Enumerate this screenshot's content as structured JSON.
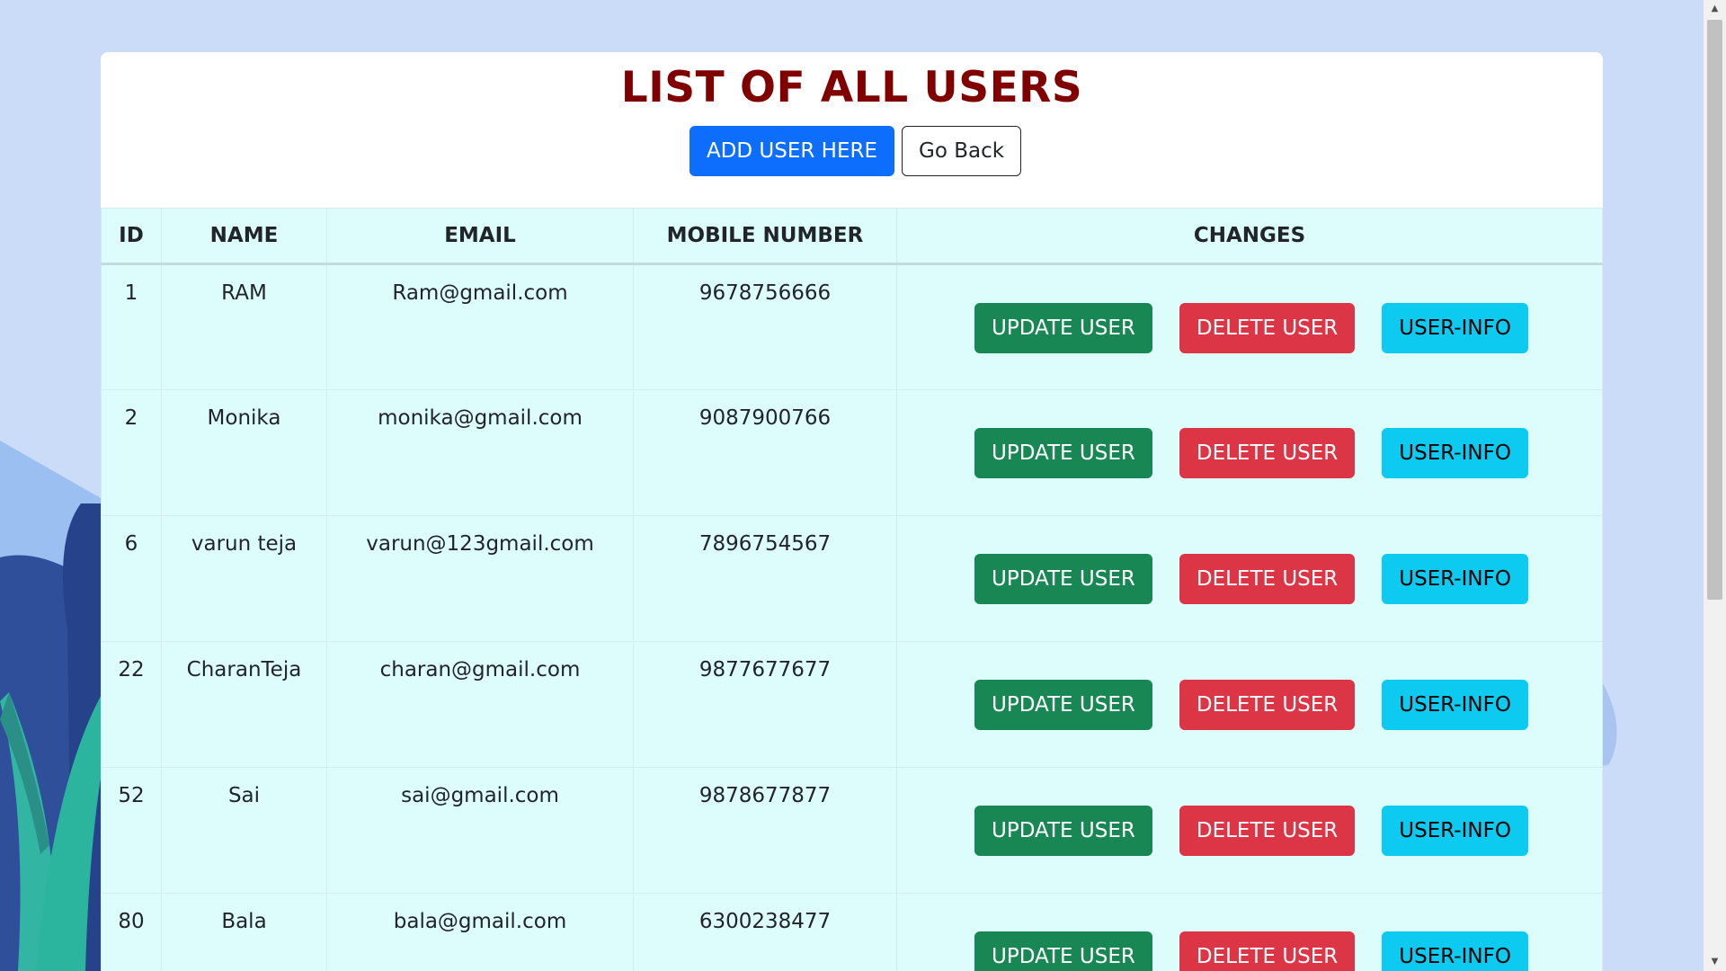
{
  "page": {
    "title": "LIST OF ALL USERS",
    "add_user_label": "ADD USER HERE",
    "go_back_label": "Go Back"
  },
  "table": {
    "headers": [
      "ID",
      "NAME",
      "EMAIL",
      "MOBILE NUMBER",
      "CHANGES"
    ],
    "rows": [
      {
        "id": "1",
        "name": "RAM",
        "email": "Ram@gmail.com",
        "mobile": "9678756666"
      },
      {
        "id": "2",
        "name": "Monika",
        "email": "monika@gmail.com",
        "mobile": "9087900766"
      },
      {
        "id": "6",
        "name": "varun teja",
        "email": "varun@123gmail.com",
        "mobile": "7896754567"
      },
      {
        "id": "22",
        "name": "CharanTeja",
        "email": "charan@gmail.com",
        "mobile": "9877677677"
      },
      {
        "id": "52",
        "name": "Sai",
        "email": "sai@gmail.com",
        "mobile": "9878677877"
      },
      {
        "id": "80",
        "name": "Bala",
        "email": "bala@gmail.com",
        "mobile": "6300238477"
      }
    ],
    "actions": {
      "update_label": "UPDATE USER",
      "delete_label": "DELETE USER",
      "info_label": "USER-INFO"
    }
  },
  "colors": {
    "page_background": "#cadcf8",
    "title": "#800000",
    "table_background": "#ddfdfd",
    "primary": "#0d6efd",
    "success": "#198754",
    "danger": "#dc3545",
    "info": "#0dcaf0"
  }
}
